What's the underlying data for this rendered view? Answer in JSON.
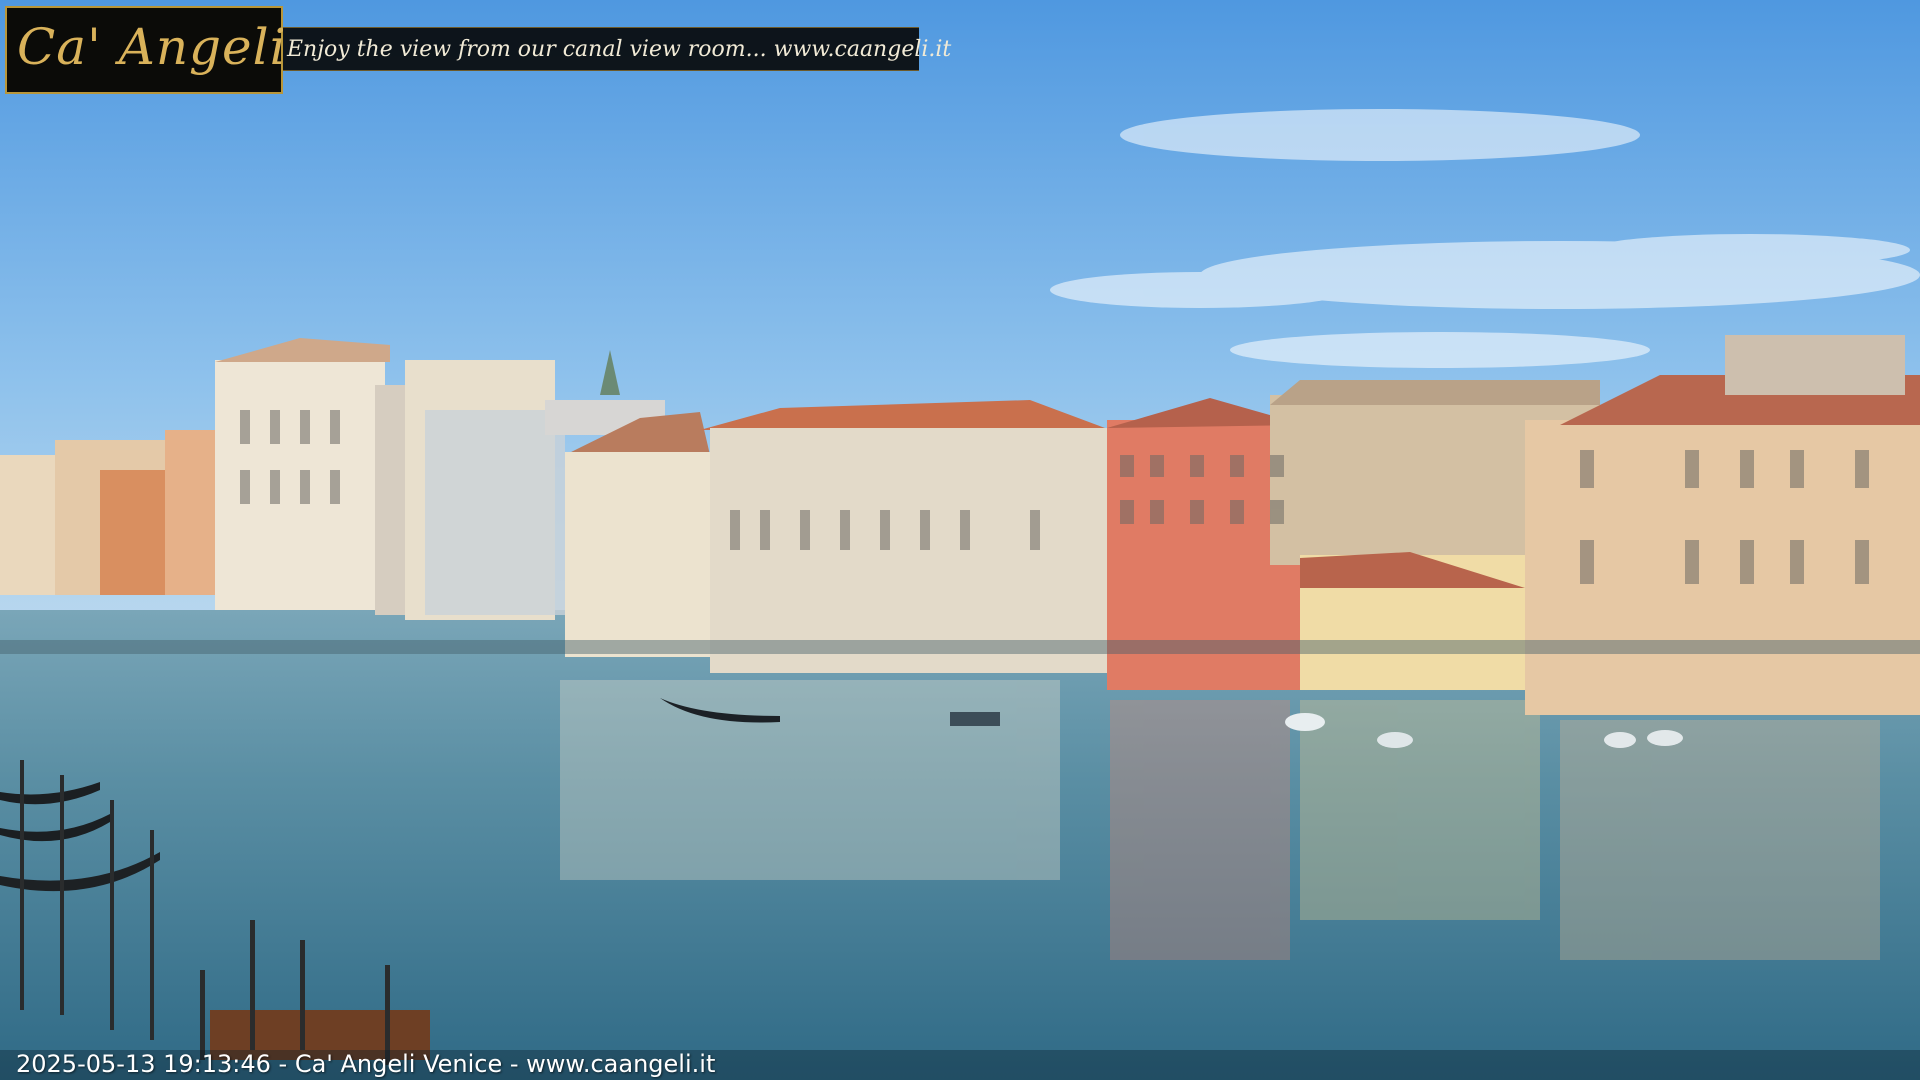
{
  "overlay": {
    "logo": "Ca' Angeli",
    "banner": "Enjoy the view from our canal view room... www.caangeli.it",
    "timestamp": "2025-05-13 19:13:46 - Ca' Angeli Venice - www.caangeli.it"
  },
  "colors": {
    "sky": "#79b3e8",
    "water": "#5f8fa3",
    "logo_gold": "#d9b25a"
  }
}
